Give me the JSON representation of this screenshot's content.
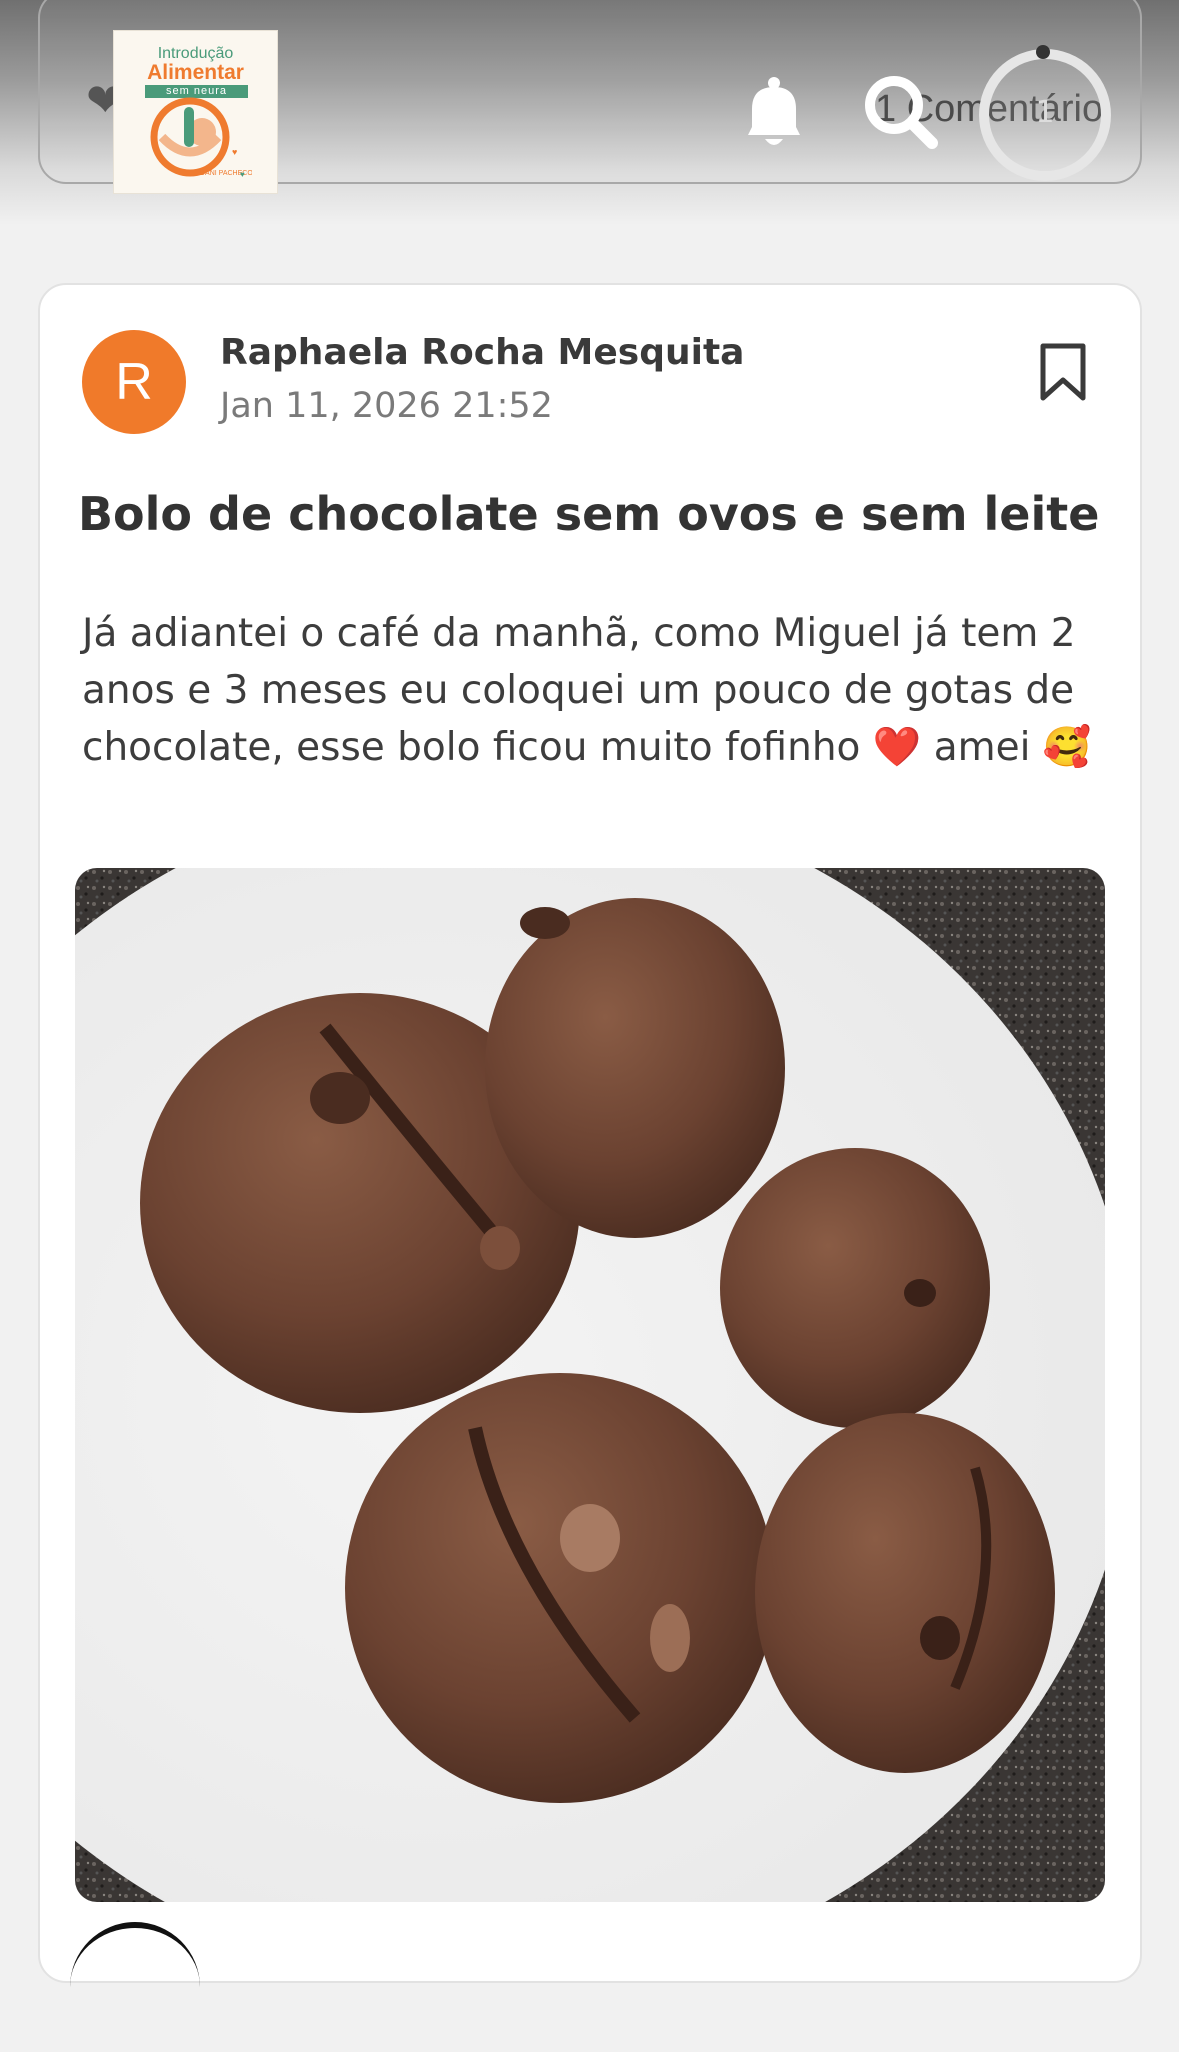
{
  "header": {
    "logo": {
      "line1": "Introdução",
      "line2": "Alimentar",
      "line3": "sem neura",
      "byline": "DANI PACHECO"
    },
    "comment_label": "1 Comentário",
    "progress_count": "1",
    "progress_fraction": 0.0
  },
  "post": {
    "avatar_letter": "R",
    "author": "Raphaela Rocha Mesquita",
    "timestamp": "Jan 11, 2026 21:52",
    "title": "Bolo de chocolate sem ovos e sem leite",
    "body": "Já adiantei o café da manhã, como Miguel já tem 2 anos e 3 meses eu coloquei um pouco de gotas de chocolate, esse bolo ficou muito fofinho ❤️ amei 🥰"
  },
  "colors": {
    "accent_orange": "#f07a2a",
    "brand_green": "#4a9b7a"
  },
  "icons": [
    "heart-icon",
    "bell-icon",
    "search-icon",
    "progress-ring-icon",
    "bookmark-icon"
  ]
}
